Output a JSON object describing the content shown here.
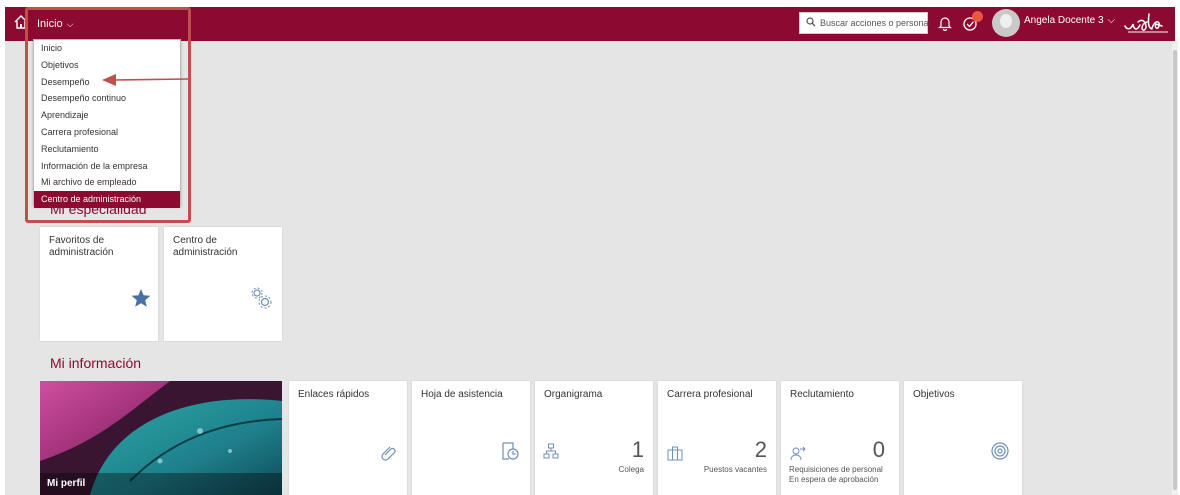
{
  "header": {
    "nav_label": "Inicio",
    "search_placeholder": "Buscar acciones o personas",
    "todo_count": "",
    "user_name": "Angela Docente 3"
  },
  "menu": {
    "items": [
      "Inicio",
      "Objetivos",
      "Desempeño",
      "Desempeño continuo",
      "Aprendizaje",
      "Carrera profesional",
      "Reclutamiento",
      "Información de la empresa",
      "Mi archivo de empleado",
      "Centro de administración"
    ],
    "active_index": 9
  },
  "sections": {
    "especialidad_title": "Mi especialidad",
    "info_title": "Mi información"
  },
  "especialidad_tiles": [
    {
      "title": "Favoritos de administración",
      "icon": "star-icon"
    },
    {
      "title": "Centro de administración",
      "icon": "gears-icon"
    }
  ],
  "info_tiles": {
    "profile_label": "Mi perfil",
    "enlaces": {
      "title": "Enlaces rápidos",
      "icon": "link-icon"
    },
    "hoja": {
      "title": "Hoja de asistencia",
      "icon": "timesheet-icon"
    },
    "organigrama": {
      "title": "Organigrama",
      "value": "1",
      "label": "Colega",
      "icon": "org-chart-icon"
    },
    "carrera": {
      "title": "Carrera profesional",
      "value": "2",
      "label": "Puestos vacantes",
      "icon": "briefcase-icon"
    },
    "reclutamiento": {
      "title": "Reclutamiento",
      "value": "0",
      "label1": "Requisiciones de personal",
      "label2": "En espera de aprobación",
      "icon": "requisition-icon"
    },
    "objetivos": {
      "title": "Objetivos",
      "icon": "target-icon"
    }
  },
  "colors": {
    "brand": "#8c0a31",
    "annotation": "#c0504d",
    "background": "#e5e5e5"
  }
}
